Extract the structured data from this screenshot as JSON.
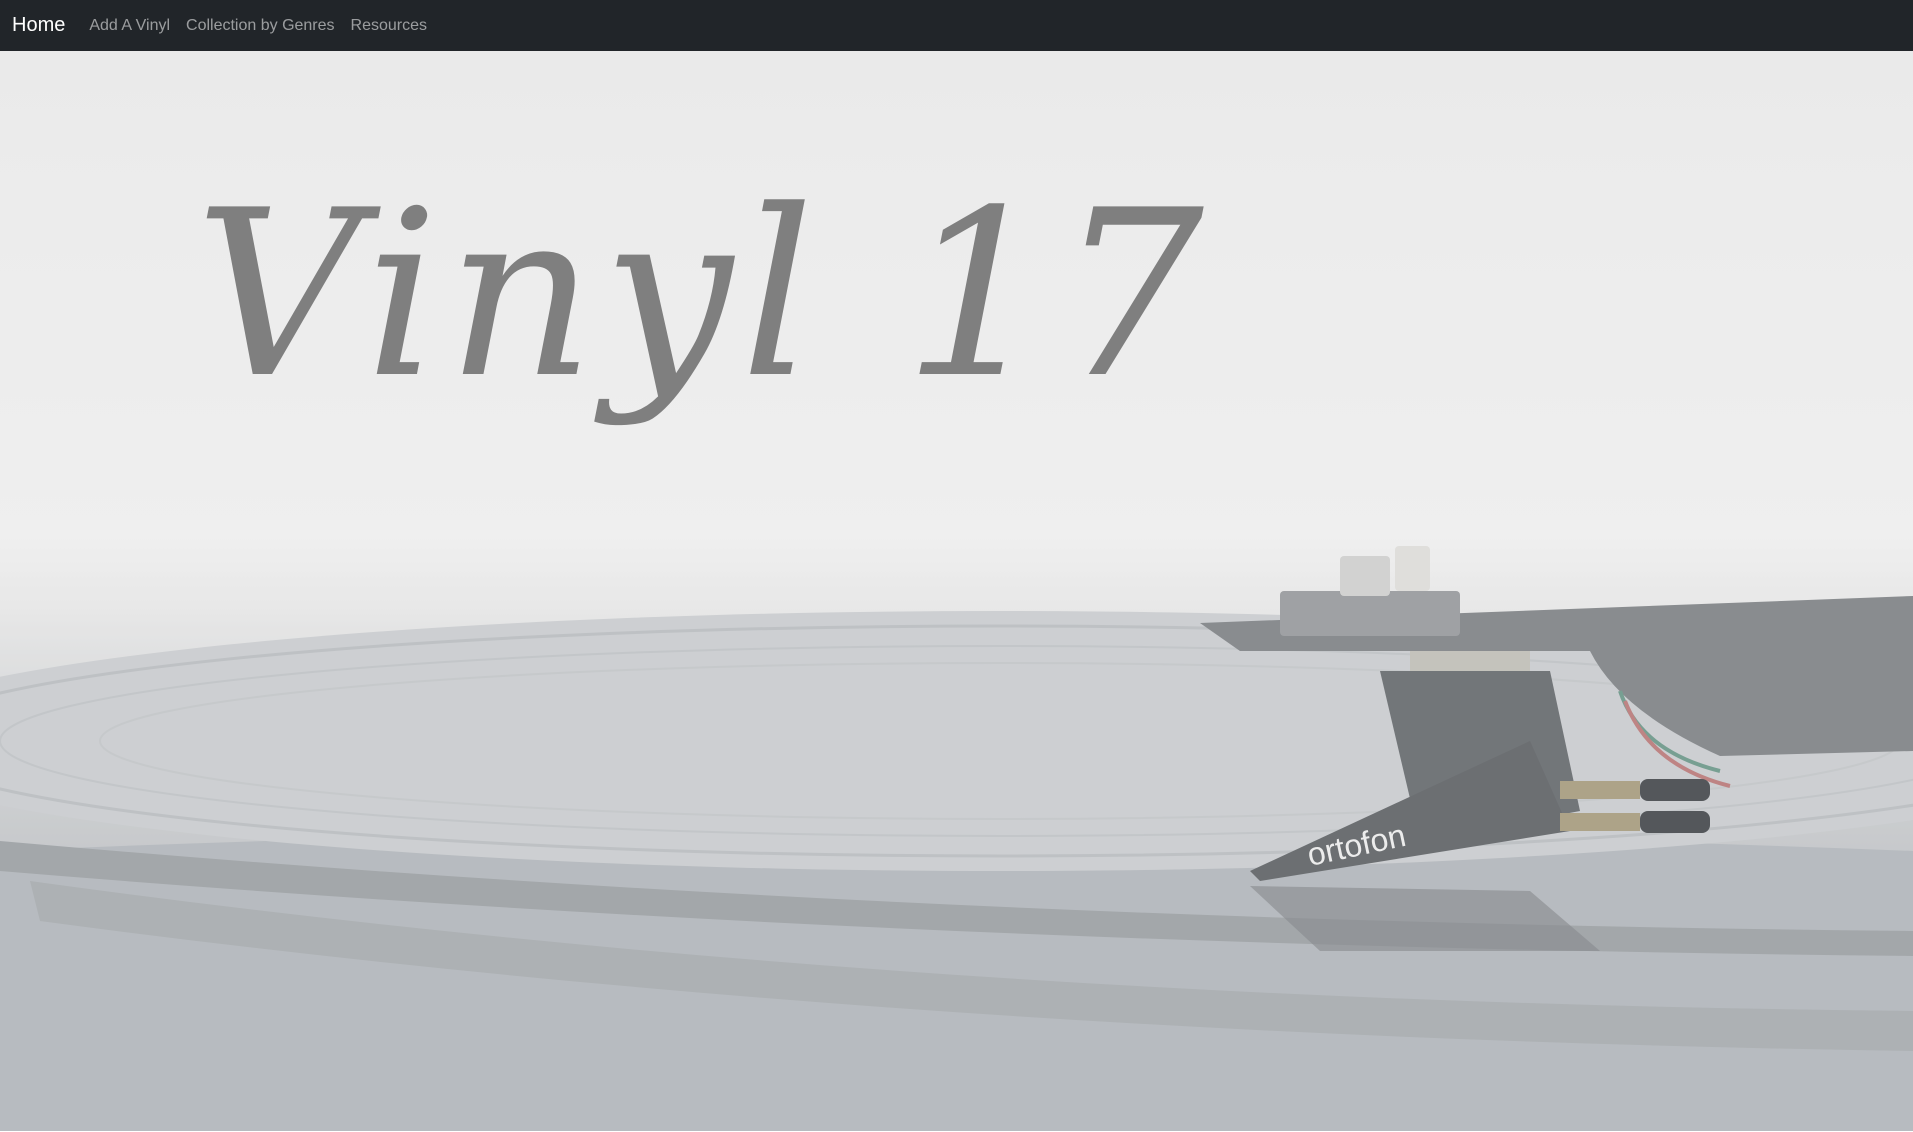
{
  "navbar": {
    "brand": "Home",
    "links": [
      "Add A Vinyl",
      "Collection by Genres",
      "Resources"
    ]
  },
  "hero": {
    "title": "Vinyl 17",
    "cartridge_brand": "ortofon"
  },
  "colors": {
    "navbar_bg": "#212529",
    "title": "#7f7f7f",
    "hero_bg": "#e6e6e6"
  }
}
